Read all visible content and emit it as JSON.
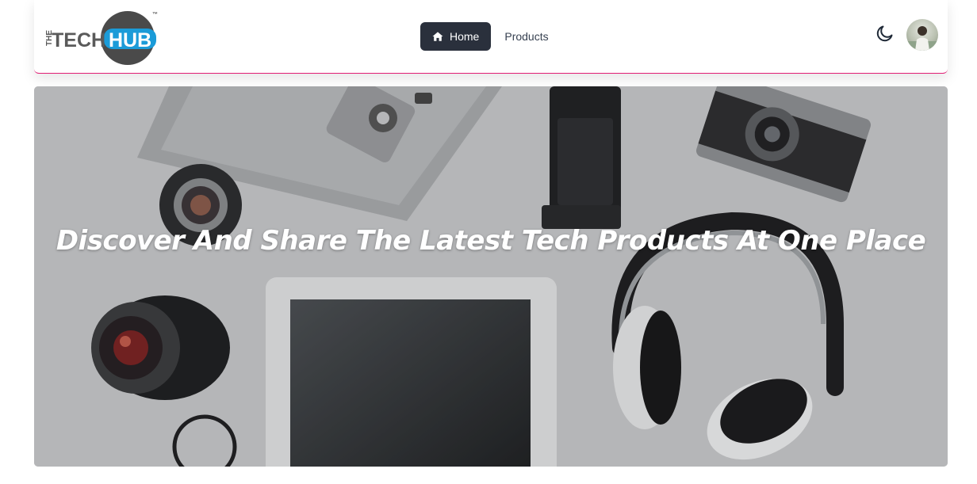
{
  "brand": {
    "logo_text_the": "THE",
    "logo_text_tech": "TECH",
    "logo_text_hub": "HUB",
    "logo_tm": "™",
    "colors": {
      "tech": "#5a5a5a",
      "hub_bg": "#1b9bd8",
      "ring": "#4a4a4a"
    }
  },
  "nav": {
    "items": [
      {
        "label": "Home",
        "icon": "home-icon",
        "active": true
      },
      {
        "label": "Products",
        "active": false
      }
    ]
  },
  "controls": {
    "theme_icon": "moon-icon",
    "avatar": "user-avatar"
  },
  "hero": {
    "title": "Discover And Share The Latest Tech Products At One Place"
  },
  "colors": {
    "accent_border": "#e11d74",
    "active_nav_bg": "#2a303c"
  }
}
